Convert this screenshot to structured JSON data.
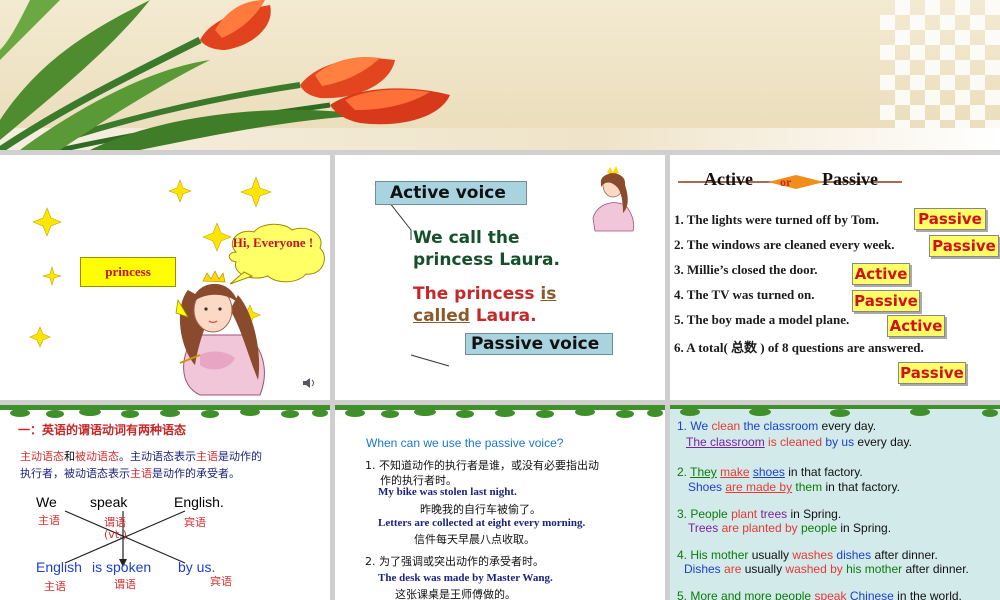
{
  "slide1": {
    "tag_label": "princess",
    "bubble_text": "Hi, Everyone !"
  },
  "slide2": {
    "active_label": "Active voice",
    "line1": "We call the",
    "line2": "princess Laura.",
    "line3a": "The princess ",
    "line3b": "is",
    "line4a": "called",
    "line4b": " Laura.",
    "passive_label": "Passive voice"
  },
  "slide3": {
    "title_left": "Active",
    "title_or": "or",
    "title_right": "Passive",
    "items": [
      {
        "text": "1.  The lights were turned off by Tom.",
        "answer": "Passive"
      },
      {
        "text": "2.  The windows are cleaned every week.",
        "answer": "Passive"
      },
      {
        "text": "3.  Millie’s closed the door.",
        "answer": "Active"
      },
      {
        "text": "4.  The TV was turned on.",
        "answer": "Passive"
      },
      {
        "text": "5.  The boy made a model plane.",
        "answer": "Active"
      },
      {
        "text": "6.  A total( 总数 ) of 8 questions are answered.",
        "answer": "Passive"
      }
    ]
  },
  "slide4": {
    "title": "一：英语的谓语动词有两种语态",
    "para1": "主动语态",
    "para2": "和",
    "para3": "被动语态",
    "para4": "。主动语态表示",
    "para5": "主语",
    "para6": "是动作的",
    "para7": "执行者，被动语态表示",
    "para8": "主语",
    "para9": "是动作的承受者。",
    "w_we": "We",
    "w_speak": "speak",
    "w_english": "English.",
    "z_subj": "主语",
    "z_pred": "谓语",
    "z_vt": "(vt.)",
    "z_obj": "宾语",
    "w_english2": "English",
    "w_isspoken": "is spoken",
    "w_byus": "by us.",
    "z_subj2": "主语",
    "z_pred2": "谓语",
    "z_obj2": "宾语"
  },
  "slide5": {
    "question": "When can we use the passive voice?",
    "point1a": "1. 不知道动作的执行者是谁，或没有必要指出动",
    "point1b": "作的执行者时。",
    "ex1_en": "My bike was stolen last night.",
    "ex1_zh": "昨晚我的自行车被偷了。",
    "ex2_en": "Letters are collected at eight every morning.",
    "ex2_zh": "信件每天早晨八点收取。",
    "point2": "2.  为了强调或突出动作的承受者时。",
    "ex3_en": "The desk was made by Master Wang.",
    "ex3_zh": "这张课桌是王师傅做的。"
  },
  "slide6": {
    "l1": [
      "1. ",
      "We",
      " ",
      "clean",
      " the ",
      "classroom",
      " every day."
    ],
    "l2": [
      "The classroom",
      " is cleaned ",
      "by us",
      " every day."
    ],
    "l3": [
      "2. ",
      "They",
      "  ",
      "make",
      "  ",
      "shoes",
      " in  that factory."
    ],
    "l4": [
      "Shoes",
      " ",
      "are made by",
      " ",
      "them",
      " in that factory."
    ],
    "l5": [
      "3. ",
      "People",
      " ",
      "plant",
      " ",
      "trees",
      " in Spring."
    ],
    "l6": [
      "Trees",
      " ",
      "are planted by",
      " ",
      "people",
      " in Spring."
    ],
    "l7": [
      "4. ",
      "His mother",
      " usually ",
      "washes",
      " ",
      "dishes",
      " after dinner."
    ],
    "l8": [
      "Dishes",
      " ",
      "are",
      " usually ",
      "washed by",
      " ",
      "his mother",
      " after dinner."
    ],
    "l9": [
      "5. ",
      "More and more people",
      " ",
      "speak",
      " ",
      "Chinese",
      " in the world."
    ]
  },
  "colors": {
    "accent_red": "#c8102e",
    "answer_bg": "#ffff66",
    "label_box": "#a9d3df",
    "slide6_bg": "#d3eaea"
  }
}
